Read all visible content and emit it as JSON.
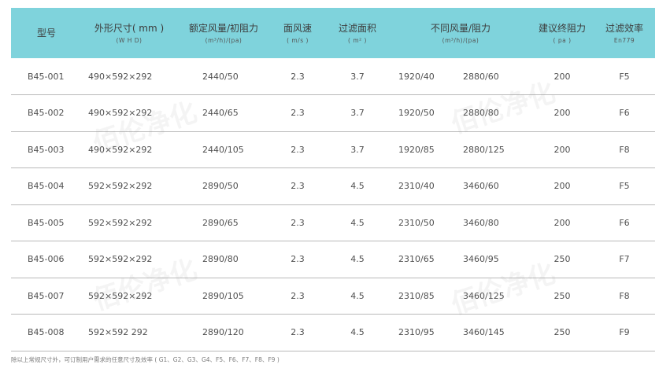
{
  "header": {
    "model": "型号",
    "size": "外形尺寸( mm )",
    "size_sub": "(W H D)",
    "airflow": "额定风量/初阻力",
    "airflow_sub": "(m³/h)/(pa)",
    "velocity": "面风速",
    "velocity_sub": "( m/s )",
    "area": "过滤面积",
    "area_sub": "( m² )",
    "variable": "不同风量/阻力",
    "variable_sub": "(m³/h)/(pa)",
    "final_resistance": "建议终阻力",
    "final_resistance_sub": "( pa )",
    "efficiency": "过滤效率",
    "efficiency_sub": "En779"
  },
  "rows": [
    {
      "model": "B45-001",
      "size": "490×592×292",
      "airflow": "2440/50",
      "velocity": "2.3",
      "area": "3.7",
      "flow1": "1920/40",
      "flow2": "2880/60",
      "final": "200",
      "grade": "F5"
    },
    {
      "model": "B45-002",
      "size": "490×592×292",
      "airflow": "2440/65",
      "velocity": "2.3",
      "area": "3.7",
      "flow1": "1920/50",
      "flow2": "2880/80",
      "final": "200",
      "grade": "F6"
    },
    {
      "model": "B45-003",
      "size": "490×592×292",
      "airflow": "2440/105",
      "velocity": "2.3",
      "area": "3.7",
      "flow1": "1920/85",
      "flow2": "2880/125",
      "final": "200",
      "grade": "F8"
    },
    {
      "model": "B45-004",
      "size": "592×592×292",
      "airflow": "2890/50",
      "velocity": "2.3",
      "area": "4.5",
      "flow1": "2310/40",
      "flow2": "3460/60",
      "final": "200",
      "grade": "F5"
    },
    {
      "model": "B45-005",
      "size": "592×592×292",
      "airflow": "2890/65",
      "velocity": "2.3",
      "area": "4.5",
      "flow1": "2310/50",
      "flow2": "3460/80",
      "final": "200",
      "grade": "F6"
    },
    {
      "model": "B45-006",
      "size": "592×592×292",
      "airflow": "2890/80",
      "velocity": "2.3",
      "area": "4.5",
      "flow1": "2310/65",
      "flow2": "3460/95",
      "final": "250",
      "grade": "F7"
    },
    {
      "model": "B45-007",
      "size": "592×592×292",
      "airflow": "2890/105",
      "velocity": "2.3",
      "area": "4.5",
      "flow1": "2310/85",
      "flow2": "3460/125",
      "final": "250",
      "grade": "F8"
    },
    {
      "model": "B45-008",
      "size": "592×592 292",
      "airflow": "2890/120",
      "velocity": "2.3",
      "area": "4.5",
      "flow1": "2310/95",
      "flow2": "3460/145",
      "final": "250",
      "grade": "F9"
    }
  ],
  "footnote": "除以上常规尺寸外，可订制用户需求的任意尺寸及效率 ( G1、G2、G3、G4、F5、F6、F7、F8、F9 )",
  "watermark": "佰伦净化",
  "colors": {
    "header_bg": "#7fd3dc",
    "row_border": "#b9b9b9"
  }
}
